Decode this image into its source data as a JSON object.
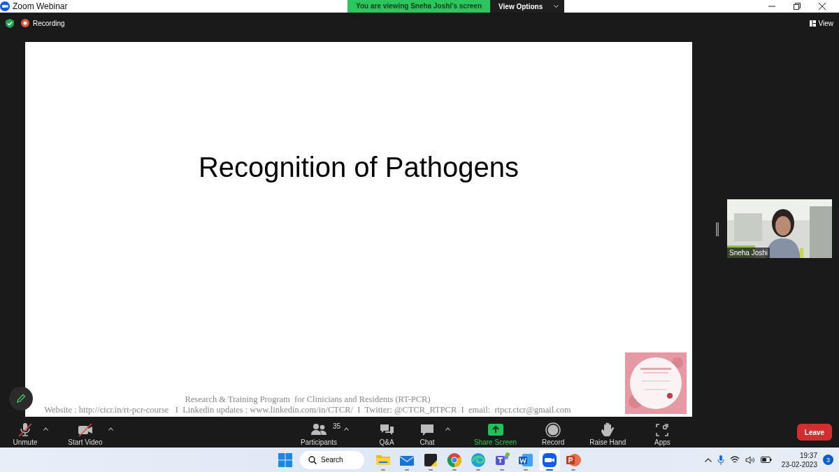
{
  "window": {
    "title": "Zoom Webinar"
  },
  "share_banner": {
    "text": "You are viewing Sneha Joshi's screen",
    "button": "View Options"
  },
  "top_bar": {
    "recording": "Recording",
    "view_button": "View"
  },
  "slide": {
    "title": "Recognition of Pathogens",
    "footer": [
      "Research & Training Program  for Clinicians and Residents (RT-PCR)",
      "Website : http://ctcr.in/rt-pcr-course   I  Linkedin updates : www.linkedin.com/in/CTCR/  I  Twitter: @CTCR_RTPCR  I  email:  rtpcr.ctcr@gmail.com"
    ]
  },
  "video_tile": {
    "name": "Sneha Joshi"
  },
  "toolbar": [
    {
      "kind": "mic",
      "label": "Unmute",
      "off": true,
      "caret": true
    },
    {
      "kind": "video",
      "label": "Start Video",
      "off": true,
      "caret": true
    },
    {
      "kind": "participants",
      "label": "Participants",
      "count": "35",
      "caret": true
    },
    {
      "kind": "qa",
      "label": "Q&A"
    },
    {
      "kind": "chat",
      "label": "Chat",
      "caret": true
    },
    {
      "kind": "share",
      "label": "Share Screen",
      "highlight": true
    },
    {
      "kind": "record",
      "label": "Record"
    },
    {
      "kind": "hand",
      "label": "Raise Hand"
    },
    {
      "kind": "apps",
      "label": "Apps"
    }
  ],
  "leave_button": "Leave",
  "taskbar": {
    "search": "Search",
    "apps": [
      {
        "kind": "explorer",
        "active": false
      },
      {
        "kind": "mail",
        "active": false
      },
      {
        "kind": "notes",
        "active": false
      },
      {
        "kind": "chrome",
        "active": false
      },
      {
        "kind": "edge",
        "active": false
      },
      {
        "kind": "teams",
        "active": false
      },
      {
        "kind": "word",
        "active": false
      },
      {
        "kind": "zoom",
        "active": true
      },
      {
        "kind": "powerpoint",
        "active": false
      }
    ],
    "time": "19:37",
    "date": "23-02-2023",
    "notifications": "3"
  }
}
